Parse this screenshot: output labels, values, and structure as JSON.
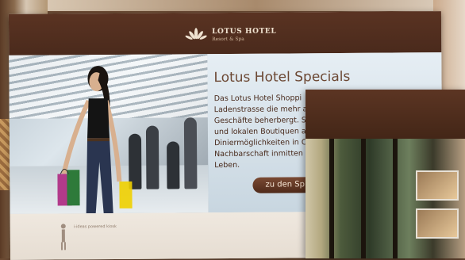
{
  "brand": {
    "name": "LOTUS HOTEL",
    "tagline": "Resort & Spa"
  },
  "specials": {
    "title": "Lotus Hotel Specials",
    "lines": [
      "Das Lotus Hotel Shoppi",
      "Ladenstrasse die mehr a",
      "Geschäfte beherbergt. S",
      "und lokalen Boutiquen a",
      "Diniermöglichkeiten in C",
      "Nachbarschaft inmitten",
      "Leben."
    ],
    "cta_label": "zu den Sp"
  },
  "footer": {
    "text": "i-ideas powered kiosk"
  },
  "colors": {
    "header_brown": "#4a2a1c",
    "title_brown": "#6c4834",
    "page_bg": "#f3efe9"
  },
  "icons": {
    "logo": "lotus-icon",
    "footer": "figure-icon"
  }
}
